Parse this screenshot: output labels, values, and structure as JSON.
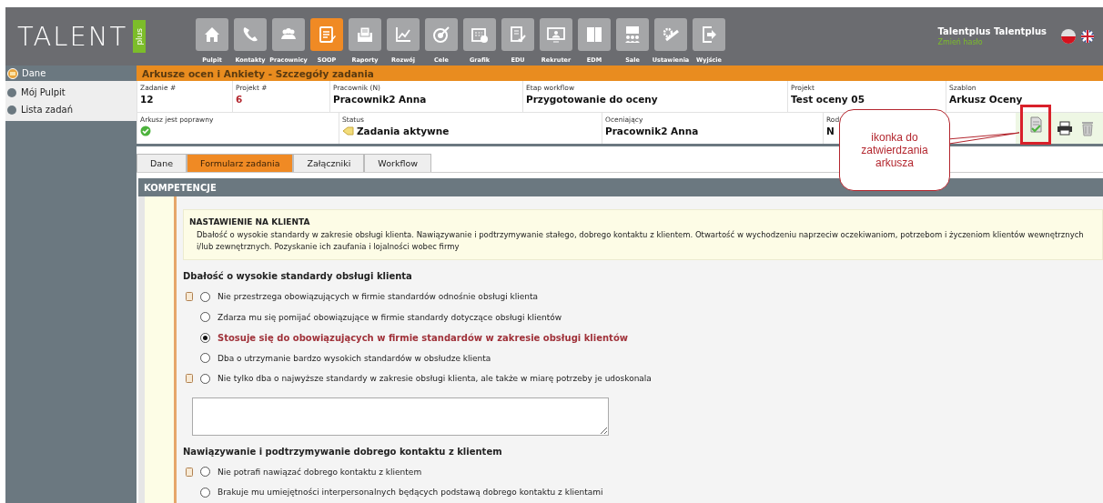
{
  "logo": {
    "text": "TALENT",
    "badge": "plus"
  },
  "nav": [
    {
      "label": "Pulpit",
      "selected": false
    },
    {
      "label": "Kontakty",
      "selected": false
    },
    {
      "label": "Pracownicy",
      "selected": false
    },
    {
      "label": "SOOP",
      "selected": true
    },
    {
      "label": "Raporty",
      "selected": false
    },
    {
      "label": "Rozwój",
      "selected": false
    },
    {
      "label": "Cele",
      "selected": false
    },
    {
      "label": "Grafik",
      "selected": false
    },
    {
      "label": "EDU",
      "selected": false
    },
    {
      "label": "Rekruter",
      "selected": false
    },
    {
      "label": "EDM",
      "selected": false
    },
    {
      "label": "Sale",
      "selected": false
    },
    {
      "label": "Ustawienia",
      "selected": false
    },
    {
      "label": "Wyjście",
      "selected": false
    }
  ],
  "user": {
    "name": "Talentplus Talentplus",
    "link": "Zmień hasło"
  },
  "sidebar": {
    "title": "Dane",
    "items": [
      {
        "label": "Mój Pulpit"
      },
      {
        "label": "Lista zadań"
      }
    ]
  },
  "page_title": "Arkusze ocen i Ankiety - Szczegóły zadania",
  "details_row1": [
    {
      "label": "Zadanie #",
      "value": "12",
      "kind": "plain"
    },
    {
      "label": "Projekt #",
      "value": "6",
      "kind": "link"
    },
    {
      "label": "Pracownik (N)",
      "value": "Pracownik2 Anna",
      "kind": "plain"
    },
    {
      "label": "Etap workflow",
      "value": "Przygotowanie do oceny",
      "kind": "plain"
    },
    {
      "label": "Projekt",
      "value": "Test oceny 05",
      "kind": "plain"
    },
    {
      "label": "Szablon",
      "value": "Arkusz Oceny",
      "kind": "plain"
    }
  ],
  "details_row2": [
    {
      "label": "Arkusz jest poprawny",
      "kind": "valid"
    },
    {
      "label": "Status",
      "value": "Zadania aktywne",
      "kind": "status"
    },
    {
      "label": "Oceniający",
      "value": "Pracownik2 Anna",
      "kind": "plain"
    },
    {
      "label": "Rod",
      "value": "N",
      "kind": "plain"
    }
  ],
  "callout": {
    "text": "ikonka do zatwierdzania arkusza"
  },
  "tabs": [
    {
      "label": "Dane",
      "selected": false
    },
    {
      "label": "Formularz zadania",
      "selected": true
    },
    {
      "label": "Załączniki",
      "selected": false
    },
    {
      "label": "Workflow",
      "selected": false
    }
  ],
  "section_title": "KOMPETENCJE",
  "competence": {
    "title": "NASTAWIENIE NA KLIENTA",
    "description": "Dbałość o wysokie standardy w zakresie obsługi klienta. Nawiązywanie i podtrzymywanie stałego, dobrego kontaktu z klientem. Otwartość w wychodzeniu naprzeciw oczekiwaniom, potrzebom i życzeniom klientów wewnętrznych i/lub zewnętrznych.  Pozyskanie ich zaufania i lojalności wobec firmy"
  },
  "questions": [
    {
      "title": "Dbałość o wysokie standardy obsługi klienta",
      "comment_box": true,
      "options": [
        {
          "label": "Nie przestrzega obowiązujących w firmie standardów odnośnie obsługi klienta",
          "selected": false,
          "note": true
        },
        {
          "label": "Zdarza mu się pomijać obowiązujące w firmie standardy dotyczące obsługi klientów",
          "selected": false,
          "note": false
        },
        {
          "label": "Stosuje się do obowiązujących w firmie standardów w zakresie obsługi klientów",
          "selected": true,
          "note": false
        },
        {
          "label": "Dba o utrzymanie bardzo wysokich standardów w obsłudze klienta",
          "selected": false,
          "note": false
        },
        {
          "label": "Nie tylko dba o najwyższe standardy w zakresie  obsługi klienta, ale także w miarę potrzeby je udoskonala",
          "selected": false,
          "note": true
        }
      ]
    },
    {
      "title": "Nawiązywanie i podtrzymywanie dobrego kontaktu z klientem",
      "comment_box": false,
      "options": [
        {
          "label": "Nie potrafi nawiązać dobrego kontaktu z klientem",
          "selected": false,
          "note": true
        },
        {
          "label": "Brakuje mu umiejętności interpersonalnych będących podstawą dobrego kontaktu z klientami",
          "selected": false,
          "note": false
        }
      ]
    }
  ]
}
